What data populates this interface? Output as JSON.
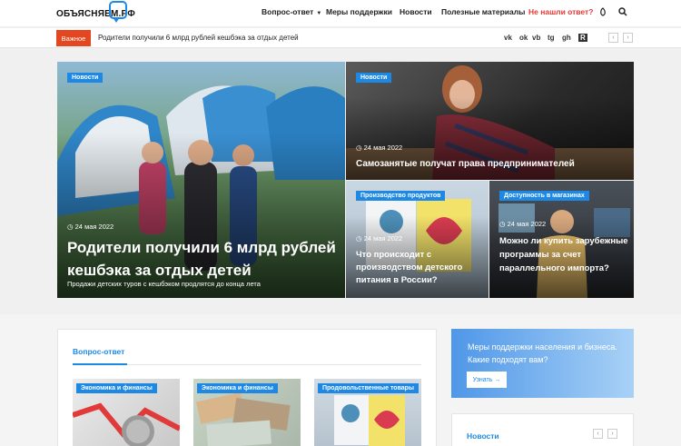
{
  "site": {
    "logo": "ОБЪЯСНЯЕМ.РФ"
  },
  "nav": {
    "items": [
      "Вопрос-ответ",
      "Меры поддержки",
      "Новости",
      "Полезные материалы"
    ],
    "highlight": "Не нашли ответ?"
  },
  "ticker": {
    "badge": "Важное",
    "text": "Родители получили 6 млрд рублей кешбэка за отдых детей",
    "social": [
      "vk",
      "ok",
      "vb",
      "tg",
      "gh",
      "R"
    ]
  },
  "hero": {
    "main": {
      "category": "Новости",
      "date": "24 мая 2022",
      "title": "Родители получили 6 млрд рублей кешбэка за отдых детей",
      "subtitle": "Продажи детских туров с кешбэком продлятся до конца лета"
    },
    "top_right": {
      "category": "Новости",
      "date": "24 мая 2022",
      "title": "Самозанятые получат права предпринимателей"
    },
    "bottom_left": {
      "category": "Производство продуктов",
      "date": "24 мая 2022",
      "title": "Что происходит с производством детского питания в России?"
    },
    "bottom_right": {
      "category": "Доступность в магазинах",
      "date": "24 мая 2022",
      "title": "Можно ли купить зарубежные программы за счет параллельного импорта?"
    }
  },
  "qa": {
    "title": "Вопрос-ответ",
    "cards": [
      {
        "category": "Экономика и финансы"
      },
      {
        "category": "Экономика и финансы"
      },
      {
        "category": "Продовольственные товары"
      }
    ]
  },
  "promo": {
    "text": "Меры поддержки населения и бизнеса. Какие подходят вам?",
    "button": "Узнать →"
  },
  "news_widget": {
    "title": "Новости"
  },
  "colors": {
    "accent": "#1e88e5",
    "alert": "#e4461f",
    "nav_highlight": "#e53935"
  }
}
